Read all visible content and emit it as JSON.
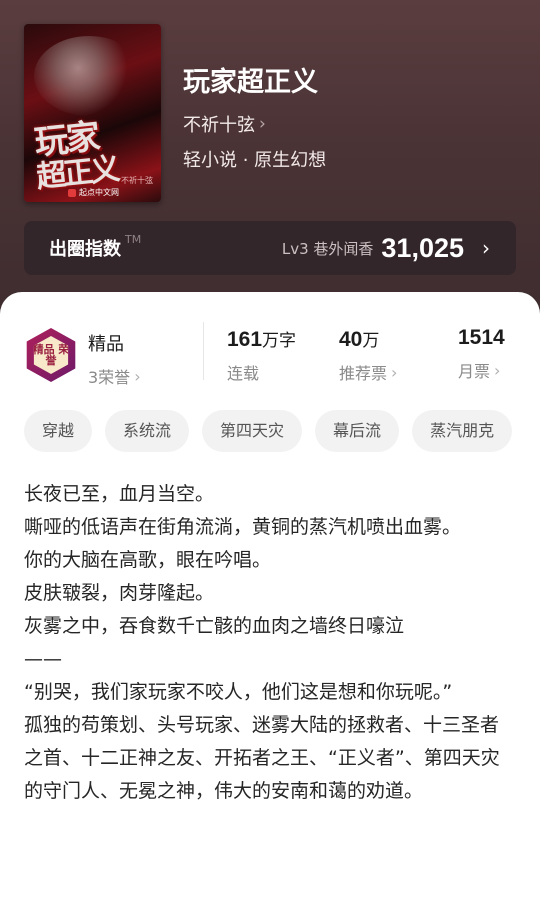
{
  "book": {
    "cover": {
      "title_line1": "玩家",
      "title_line2": "超正义",
      "author": "不祈十弦",
      "publisher_logo": "起点中文网"
    },
    "title": "玩家超正义",
    "author": "不祈十弦",
    "genre": "轻小说 · 原生幻想"
  },
  "index": {
    "label": "出圈指数",
    "tm": "TM",
    "rank": "Lv3 巷外闻香",
    "value": "31,025"
  },
  "stats": {
    "quality": {
      "badge_text": "精品",
      "badge_sub": "3荣誉",
      "badge_icon_text": "精品 荣誉"
    },
    "words": {
      "value": "161",
      "unit": "万字",
      "label": "连载"
    },
    "recommend": {
      "value": "40",
      "unit": "万",
      "label": "推荐票"
    },
    "monthly": {
      "value": "1514",
      "label": "月票"
    }
  },
  "tags": [
    "穿越",
    "系统流",
    "第四天灾",
    "幕后流",
    "蒸汽朋克"
  ],
  "description": [
    "长夜已至，血月当空。",
    "嘶哑的低语声在街角流淌，黄铜的蒸汽机喷出血雾。",
    "你的大脑在高歌，眼在吟唱。",
    "皮肤皲裂，肉芽隆起。",
    "灰雾之中，吞食数千亡骸的血肉之墙终日嚎泣",
    "——",
    "“别哭，我们家玩家不咬人，他们这是想和你玩呢。”",
    "孤独的苟策划、头号玩家、迷雾大陆的拯救者、十三圣者之首、十二正神之友、开拓者之王、“正义者”、第四天灾的守门人、无冕之神，伟大的安南和蔼的劝道。"
  ],
  "colors": {
    "hero": "#4a3335",
    "panel": "#ffffff",
    "tag_bg": "#f2f2f2"
  }
}
